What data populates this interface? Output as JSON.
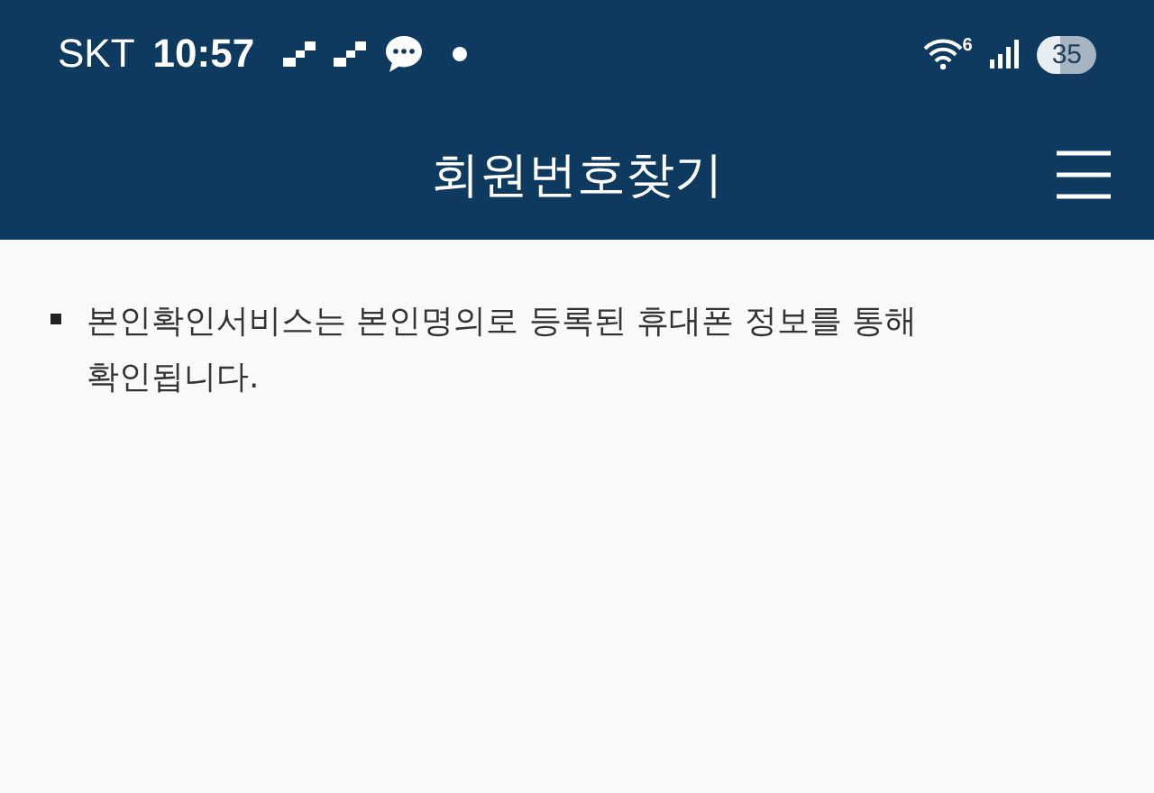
{
  "status_bar": {
    "carrier": "SKT",
    "time": "10:57",
    "wifi_badge": "6",
    "battery": "35"
  },
  "header": {
    "title": "회원번호찾기"
  },
  "notes": [
    "본인확인서비스는 본인명의로 등록된 휴대폰 정보를 통해 확인됩니다."
  ]
}
